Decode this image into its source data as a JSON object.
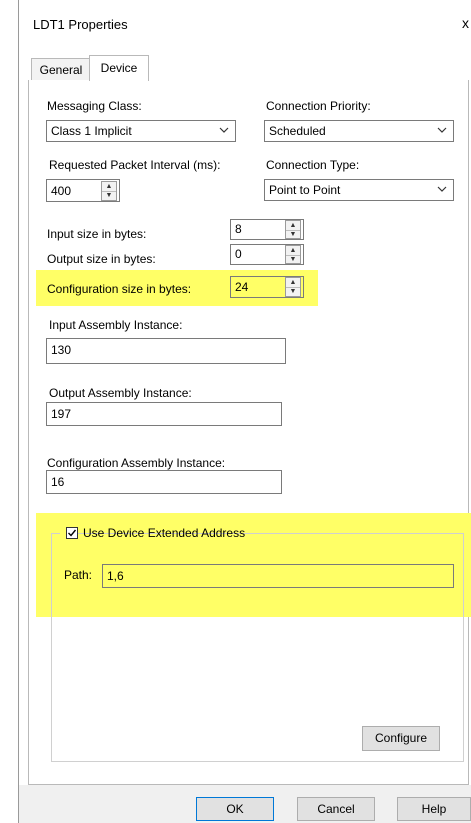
{
  "window": {
    "title": "LDT1 Properties",
    "close_glyph": "x"
  },
  "tabs": [
    {
      "label": "General"
    },
    {
      "label": "Device"
    }
  ],
  "messaging_class": {
    "label": "Messaging Class:",
    "value": "Class 1 Implicit"
  },
  "connection_priority": {
    "label": "Connection Priority:",
    "value": "Scheduled"
  },
  "rpi": {
    "label": "Requested Packet Interval (ms):",
    "value": "400"
  },
  "connection_type": {
    "label": "Connection Type:",
    "value": "Point to Point"
  },
  "input_size": {
    "label": "Input size in bytes:",
    "value": "8"
  },
  "output_size": {
    "label": "Output size in bytes:",
    "value": "0"
  },
  "config_size": {
    "label": "Configuration size in bytes:",
    "value": "24"
  },
  "input_assembly": {
    "label": "Input Assembly Instance:",
    "value": "130"
  },
  "output_assembly": {
    "label": "Output Assembly Instance:",
    "value": "197"
  },
  "config_assembly": {
    "label": "Configuration Assembly Instance:",
    "value": "16"
  },
  "extended_address": {
    "label": "Use Device Extended Address",
    "checked": true,
    "path_label": "Path:",
    "path_value": "1,6"
  },
  "buttons": {
    "configure": "Configure",
    "ok": "OK",
    "cancel": "Cancel",
    "help": "Help"
  },
  "colors": {
    "highlight": "#ffff66",
    "default_button_border": "#0078d7"
  }
}
